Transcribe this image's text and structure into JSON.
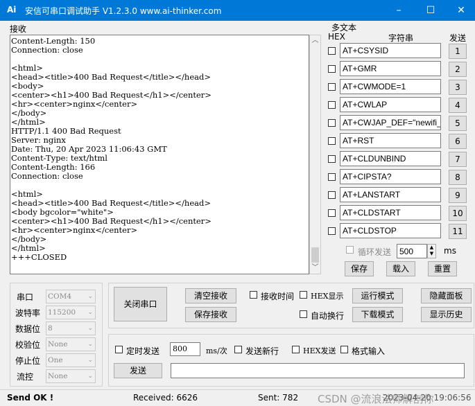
{
  "window": {
    "app_icon": "Ai",
    "title": "安信可串口调试助手 V1.2.3.0    www.ai-thinker.com",
    "minimize": "–",
    "maximize": "☐",
    "close": "✕"
  },
  "receive": {
    "group_label": "接收",
    "content": "Content-Length: 150\nConnection: close\n\n<html>\n<head><title>400 Bad Request</title></head>\n<body>\n<center><h1>400 Bad Request</h1></center>\n<hr><center>nginx</center>\n</body>\n</html>\nHTTP/1.1 400 Bad Request\nServer: nginx\nDate: Thu, 20 Apr 2023 11:06:43 GMT\nContent-Type: text/html\nContent-Length: 166\nConnection: close\n\n<html>\n<head><title>400 Bad Request</title></head>\n<body bgcolor=\"white\">\n<center><h1>400 Bad Request</h1></center>\n<hr><center>nginx</center>\n</body>\n</html>\n+++CLOSED",
    "scroll_up": "︿",
    "scroll_down": "﹀"
  },
  "multi_text": {
    "group_label": "多文本",
    "col_hex": "HEX",
    "col_string": "字符串",
    "col_send": "发送",
    "rows": [
      {
        "value": "AT+CSYSID",
        "num": "1"
      },
      {
        "value": "AT+GMR",
        "num": "2"
      },
      {
        "value": "AT+CWMODE=1",
        "num": "3"
      },
      {
        "value": "AT+CWLAP",
        "num": "4"
      },
      {
        "value": "AT+CWJAP_DEF=\"newifi_",
        "num": "5"
      },
      {
        "value": "AT+RST",
        "num": "6"
      },
      {
        "value": "AT+CLDUNBIND",
        "num": "7"
      },
      {
        "value": "AT+CIPSTA?",
        "num": "8"
      },
      {
        "value": "AT+LANSTART",
        "num": "9"
      },
      {
        "value": "AT+CLDSTART",
        "num": "10"
      },
      {
        "value": "AT+CLDSTOP",
        "num": "11"
      }
    ],
    "loop_send_label": "循环发送",
    "loop_interval": "500",
    "ms": "ms",
    "save": "保存",
    "load": "载入",
    "reset": "重置"
  },
  "port_settings": {
    "port_label": "串口",
    "port_value": "COM4",
    "baud_label": "波特率",
    "baud_value": "115200",
    "databits_label": "数据位",
    "databits_value": "8",
    "parity_label": "校验位",
    "parity_value": "None",
    "stopbits_label": "停止位",
    "stopbits_value": "One",
    "flow_label": "流控",
    "flow_value": "None"
  },
  "controls": {
    "close_port": "关闭串口",
    "clear_receive": "清空接收",
    "save_receive": "保存接收",
    "recv_time": "接收时间",
    "hex_display": "HEX显示",
    "auto_newline": "自动换行",
    "run_mode": "运行模式",
    "download_mode": "下载模式",
    "hide_panel": "隐藏面板",
    "show_history": "显示历史"
  },
  "send_area": {
    "timed_send": "定时发送",
    "interval": "800",
    "unit": "ms/次",
    "send_newline": "发送新行",
    "hex_send": "HEX发送",
    "format_input": "格式输入",
    "send_button": "发送",
    "input_value": ""
  },
  "status": {
    "send_ok": "Send OK !",
    "received": "Received: 6626",
    "sent": "Sent: 782",
    "watermark": "CSDN @流浪法师解剖你",
    "datetime": "2023-04-20 19:06:56"
  }
}
